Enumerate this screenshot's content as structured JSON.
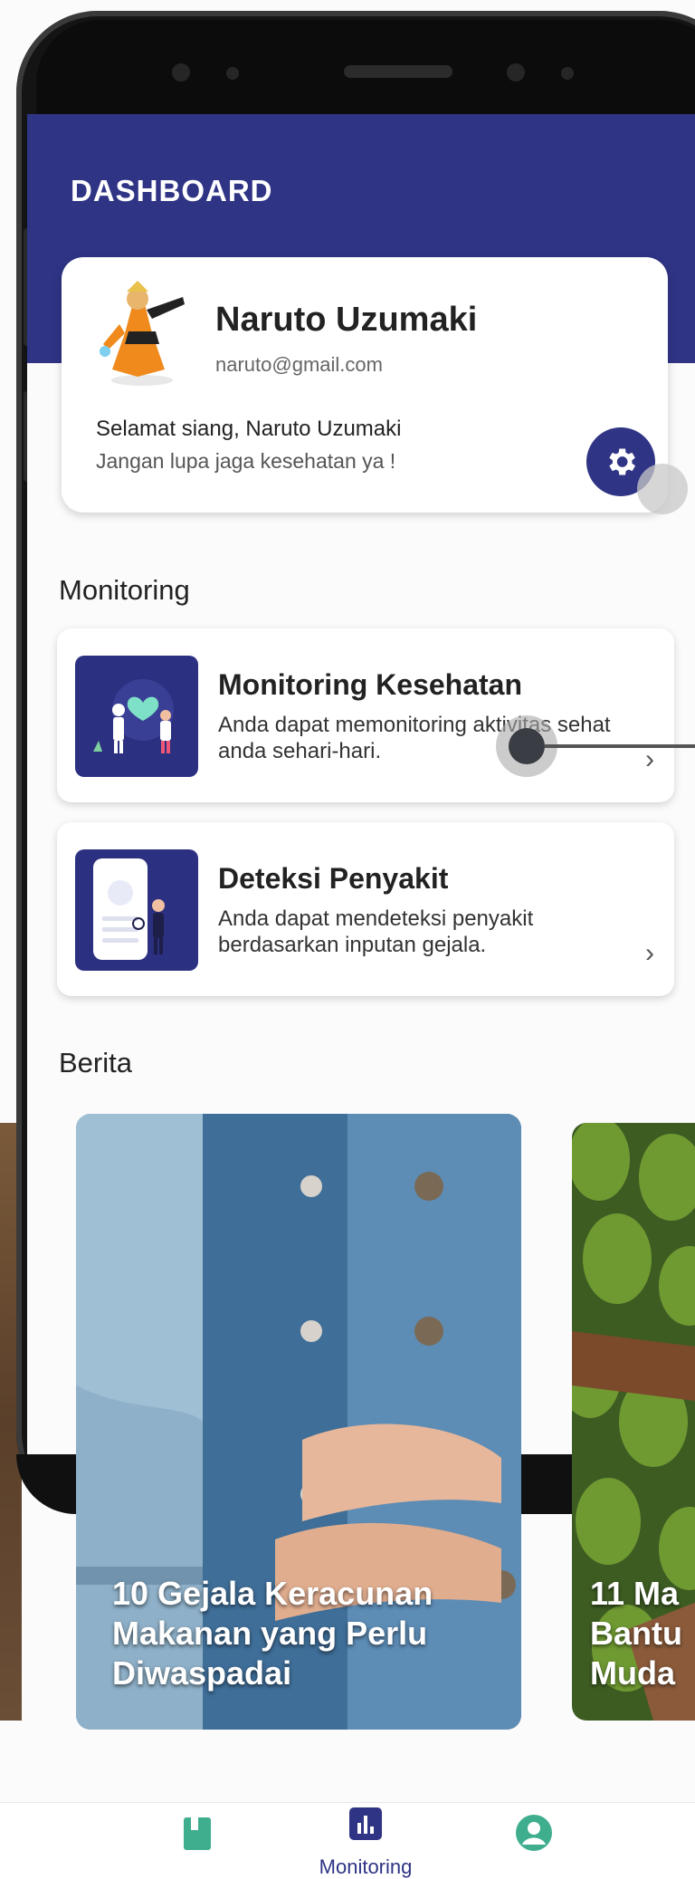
{
  "header": {
    "title": "DASHBOARD"
  },
  "profile": {
    "name": "Naruto Uzumaki",
    "email": "naruto@gmail.com",
    "greeting": "Selamat siang, Naruto Uzumaki",
    "subtitle": "Jangan lupa jaga kesehatan ya !"
  },
  "sections": {
    "monitoring": "Monitoring",
    "news": "Berita"
  },
  "menu": [
    {
      "title": "Monitoring Kesehatan",
      "desc": "Anda dapat memonitoring aktivitas sehat anda sehari-hari.",
      "icon": "health-monitor-illustration"
    },
    {
      "title": "Deteksi Penyakit",
      "desc": "Anda dapat mendeteksi penyakit berdasarkan inputan gejala.",
      "icon": "phone-doctor-illustration"
    }
  ],
  "news": [
    {
      "title": "10 Gejala Keracunan Makanan yang Perlu Diwaspadai"
    },
    {
      "title": "11 Ma Bantu Muda"
    }
  ],
  "bottom_nav": [
    {
      "label": "",
      "icon": "book-icon"
    },
    {
      "label": "Monitoring",
      "icon": "chart-icon"
    },
    {
      "label": "",
      "icon": "account-icon"
    }
  ],
  "colors": {
    "primary": "#2f3485",
    "background": "#fbfbfb"
  }
}
